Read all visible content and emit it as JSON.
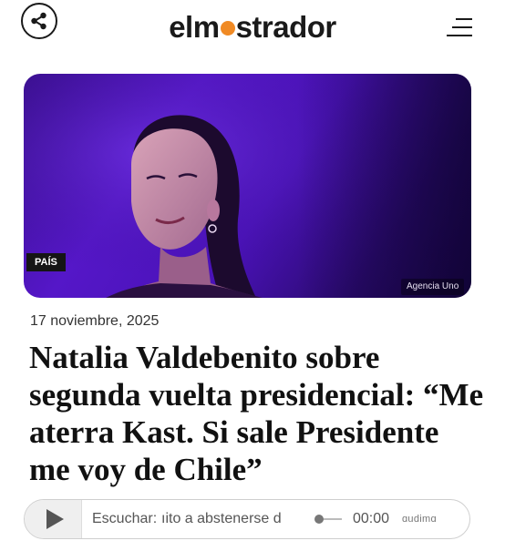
{
  "header": {
    "logo_left": "elm",
    "logo_right": "strador",
    "logo_dot_color": "#f08a24",
    "share_icon": "share-icon",
    "menu_icon": "hamburger-menu-icon"
  },
  "article": {
    "section_badge": "PAÍS",
    "photo_credit": "Agencia Uno",
    "date": "17 noviembre, 2025",
    "headline": "Natalia Valdebenito sobre segunda vuelta presidencial: “Me aterra Kast. Si sale Presidente me voy de Chile”"
  },
  "player": {
    "play_icon": "play-icon",
    "listen_label": "Escuchar:",
    "ticker_text": "ıito a abstenerse d",
    "time": "00:00",
    "brand": "ɑudimɑ",
    "progress": 0
  }
}
